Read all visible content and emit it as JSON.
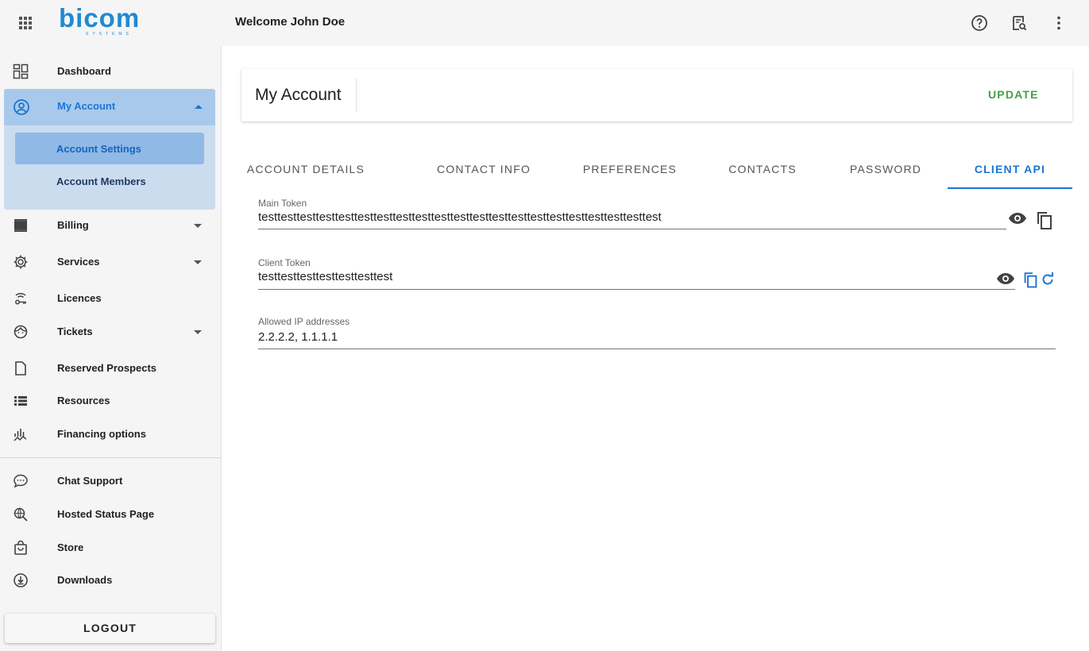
{
  "header": {
    "logo_text": "bicom",
    "logo_sub": "SYSTEMS",
    "welcome": "Welcome John Doe",
    "icons": [
      "apps-grid-icon",
      "help-icon",
      "search-doc-icon",
      "more-vert-icon"
    ]
  },
  "sidebar": {
    "dashboard": "Dashboard",
    "my_account": "My Account",
    "account_settings": "Account Settings",
    "account_members": "Account Members",
    "billing": "Billing",
    "services": "Services",
    "licences": "Licences",
    "tickets": "Tickets",
    "reserved_prospects": "Reserved Prospects",
    "resources": "Resources",
    "financing_options": "Financing options",
    "chat_support": "Chat Support",
    "hosted_status_page": "Hosted Status Page",
    "store": "Store",
    "downloads": "Downloads",
    "logout": "LOGOUT"
  },
  "page": {
    "title": "My Account",
    "update_label": "UPDATE"
  },
  "tabs": {
    "account_details": "ACCOUNT DETAILS",
    "contact_info": "CONTACT INFO",
    "preferences": "PREFERENCES",
    "contacts": "CONTACTS",
    "password": "PASSWORD",
    "client_api": "CLIENT API",
    "active": "CLIENT API"
  },
  "fields": {
    "main_token": {
      "label": "Main Token",
      "value": "testtesttesttesttesttesttesttesttesttesttesttesttesttesttesttesttesttesttesttesttest"
    },
    "client_token": {
      "label": "Client Token",
      "value": "testtesttesttesttesttesttest"
    },
    "allowed_ips": {
      "label": "Allowed IP addresses",
      "value": "2.2.2.2, 1.1.1.1"
    }
  },
  "colors": {
    "brand": "#1f8ad2",
    "accent": "#1976d2",
    "update": "#43a047",
    "active_group": "#a9c9ec"
  }
}
